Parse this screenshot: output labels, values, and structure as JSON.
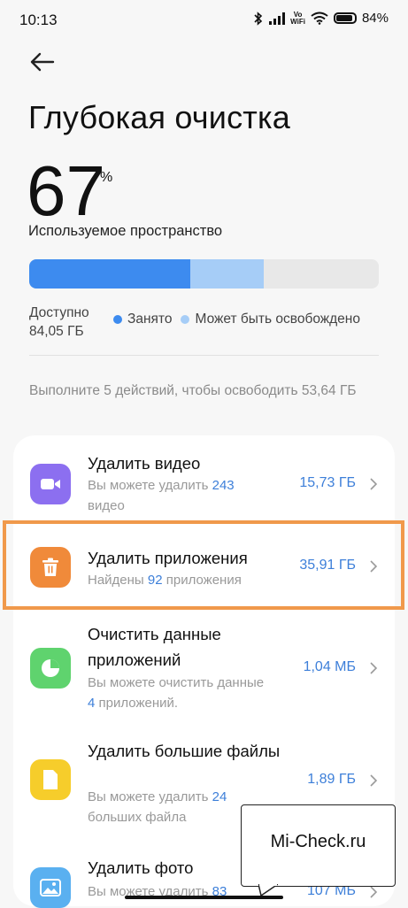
{
  "status": {
    "time": "10:13",
    "vowifi_top": "Vo",
    "vowifi_bottom": "WiFi",
    "battery": "84%"
  },
  "header": {
    "title": "Глубокая очистка"
  },
  "storage": {
    "percent": "67",
    "percent_sign": "%",
    "used_label": "Используемое пространство",
    "used_fraction": 0.46,
    "freeable_fraction": 0.21,
    "available_label": "Доступно",
    "available_value": "84,05 ГБ",
    "legend_used": "Занято",
    "legend_freeable": "Может быть освобождено",
    "colors": {
      "used": "#3d8bef",
      "freeable": "#a6cdf7",
      "track": "#e8e8e8"
    }
  },
  "hint": "Выполните 5 действий, чтобы освободить 53,64 ГБ",
  "actions": [
    {
      "title": "Удалить видео",
      "desc_before": "Вы можете удалить ",
      "count": "243",
      "desc_after": " видео",
      "size": "15,73 ГБ",
      "icon": "video-icon",
      "color": "#8c6ff0"
    },
    {
      "title": "Удалить приложения",
      "desc_before": "Найдены ",
      "count": "92",
      "desc_after": " приложения",
      "size": "35,91 ГБ",
      "icon": "trash-icon",
      "color": "#f08a3a"
    },
    {
      "title": "Очистить данные приложений",
      "desc_before": "Вы можете очистить данные ",
      "count": "4",
      "desc_after": " приложений.",
      "size": "1,04 МБ",
      "icon": "pie-chart-icon",
      "color": "#5fd36e"
    },
    {
      "title": "Удалить большие файлы",
      "desc_before": "Вы можете удалить ",
      "count": "24",
      "desc_after": " больших файла",
      "size": "1,89 ГБ",
      "icon": "file-icon",
      "color": "#f6cd2b"
    },
    {
      "title": "Удалить фото",
      "desc_before": "Вы можете удалить ",
      "count": "83",
      "desc_after": "",
      "size": "107 МБ",
      "icon": "image-icon",
      "color": "#5ab0f0"
    }
  ],
  "watermark": "Mi-Check.ru"
}
